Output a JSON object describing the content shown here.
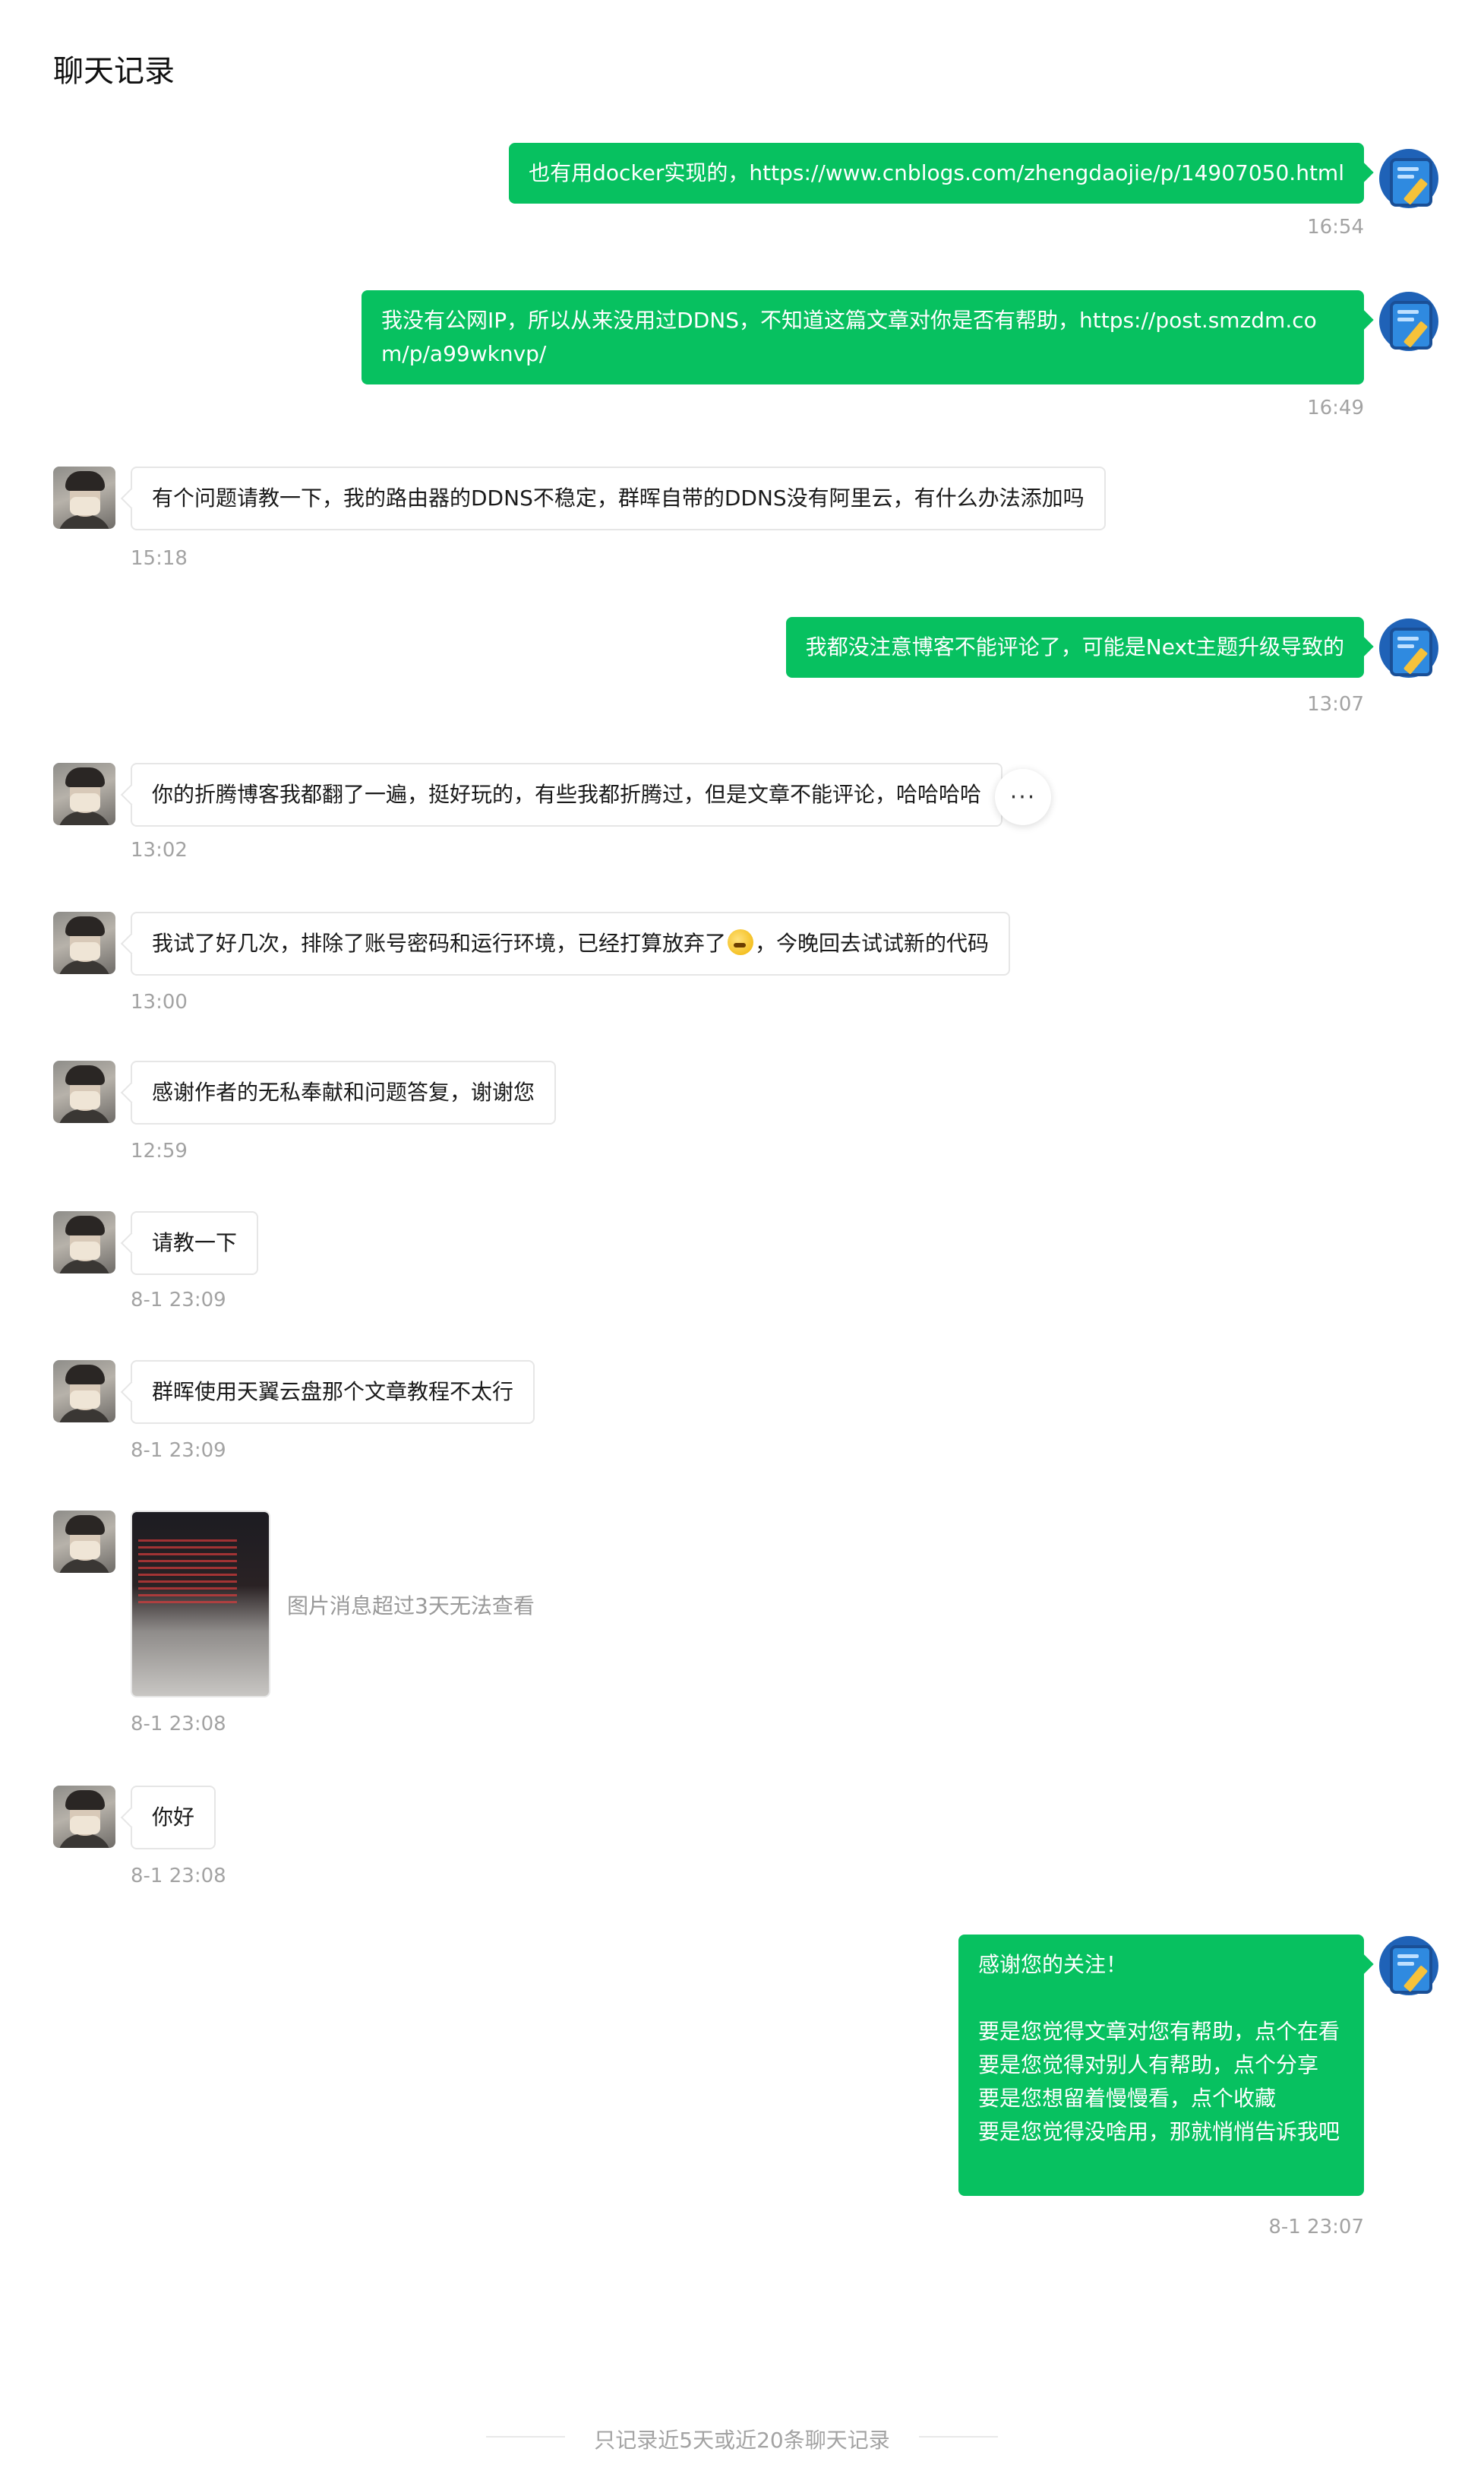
{
  "page": {
    "title": "聊天记录"
  },
  "messages": [
    {
      "direction": "out",
      "text": "也有用docker实现的，https://www.cnblogs.com/zhengdaojie/p/14907050.html",
      "time": "16:54"
    },
    {
      "direction": "out",
      "text": "我没有公网IP，所以从来没用过DDNS，不知道这篇文章对你是否有帮助，https://post.smzdm.com/p/a99wknvp/",
      "time": "16:49"
    },
    {
      "direction": "in",
      "text": "有个问题请教一下，我的路由器的DDNS不稳定，群晖自带的DDNS没有阿里云，有什么办法添加吗",
      "time": "15:18"
    },
    {
      "direction": "out",
      "text": "我都没注意博客不能评论了，可能是Next主题升级导致的",
      "time": "13:07"
    },
    {
      "direction": "in",
      "text": "你的折腾博客我都翻了一遍，挺好玩的，有些我都折腾过，但是文章不能评论，哈哈哈哈",
      "time": "13:02"
    },
    {
      "direction": "in",
      "text_before": "我试了好几次，排除了账号密码和运行环境，已经打算放弃了",
      "emoji": "crying-face-emoji",
      "text_after": "，今晚回去试试新的代码",
      "time": "13:00"
    },
    {
      "direction": "in",
      "text": "感谢作者的无私奉献和问题答复，谢谢您",
      "time": "12:59"
    },
    {
      "direction": "in",
      "text": "请教一下",
      "time": "8-1 23:09"
    },
    {
      "direction": "in",
      "text": "群晖使用天翼云盘那个文章教程不太行",
      "time": "8-1 23:09"
    },
    {
      "direction": "in",
      "image_note": "图片消息超过3天无法查看",
      "time": "8-1 23:08"
    },
    {
      "direction": "in",
      "text": "你好",
      "time": "8-1 23:08"
    },
    {
      "direction": "out",
      "text": "感谢您的关注！\n\n要是您觉得文章对您有帮助，点个在看\n要是您觉得对别人有帮助，点个分享\n要是您想留着慢慢看，点个收藏\n要是您觉得没啥用，那就悄悄告诉我吧",
      "time": "8-1 23:07"
    }
  ],
  "more_button": {
    "label": "···"
  },
  "footer": {
    "text": "只记录近5天或近20条聊天记录"
  },
  "colors": {
    "outgoing_bubble": "#07c160",
    "incoming_bubble": "#ffffff",
    "timestamp": "#a3a3a3"
  }
}
